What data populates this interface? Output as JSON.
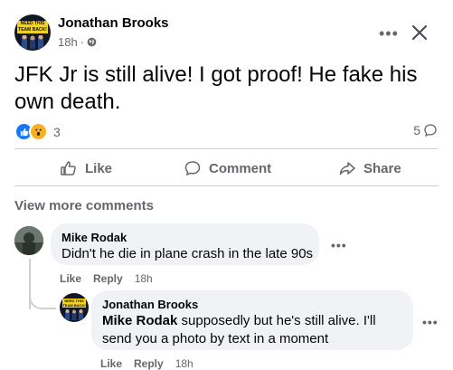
{
  "post": {
    "author": "Jonathan Brooks",
    "avatar_badge": "NEED THIS TEAM BACK!",
    "time": "18h",
    "privacy_icon": "globe-icon",
    "text": "JFK Jr is still alive! I got proof! He fake his own death.",
    "reaction_icons": [
      "like-reaction-icon",
      "wow-reaction-icon"
    ],
    "reaction_count": "3",
    "comment_count": "5",
    "more_icon": "ellipsis-icon",
    "close_icon": "close-icon"
  },
  "actions": {
    "like": "Like",
    "comment": "Comment",
    "share": "Share"
  },
  "comments_header": "View more comments",
  "comments": [
    {
      "author": "Mike Rodak",
      "text": "Didn't he die in plane crash in the late 90s",
      "like": "Like",
      "reply": "Reply",
      "time": "18h"
    }
  ],
  "reply": {
    "author": "Jonathan Brooks",
    "avatar_badge": "NEED THIS TEAM BACK!",
    "mention": "Mike Rodak",
    "text_line1": " supposedly but he's still alive. I'll",
    "text_line2": "send you a photo by text in a moment",
    "like": "Like",
    "reply": "Reply",
    "time": "18h"
  },
  "colors": {
    "accent": "#1877f2",
    "secondary_text": "#65676b",
    "bubble": "#f0f2f5"
  }
}
